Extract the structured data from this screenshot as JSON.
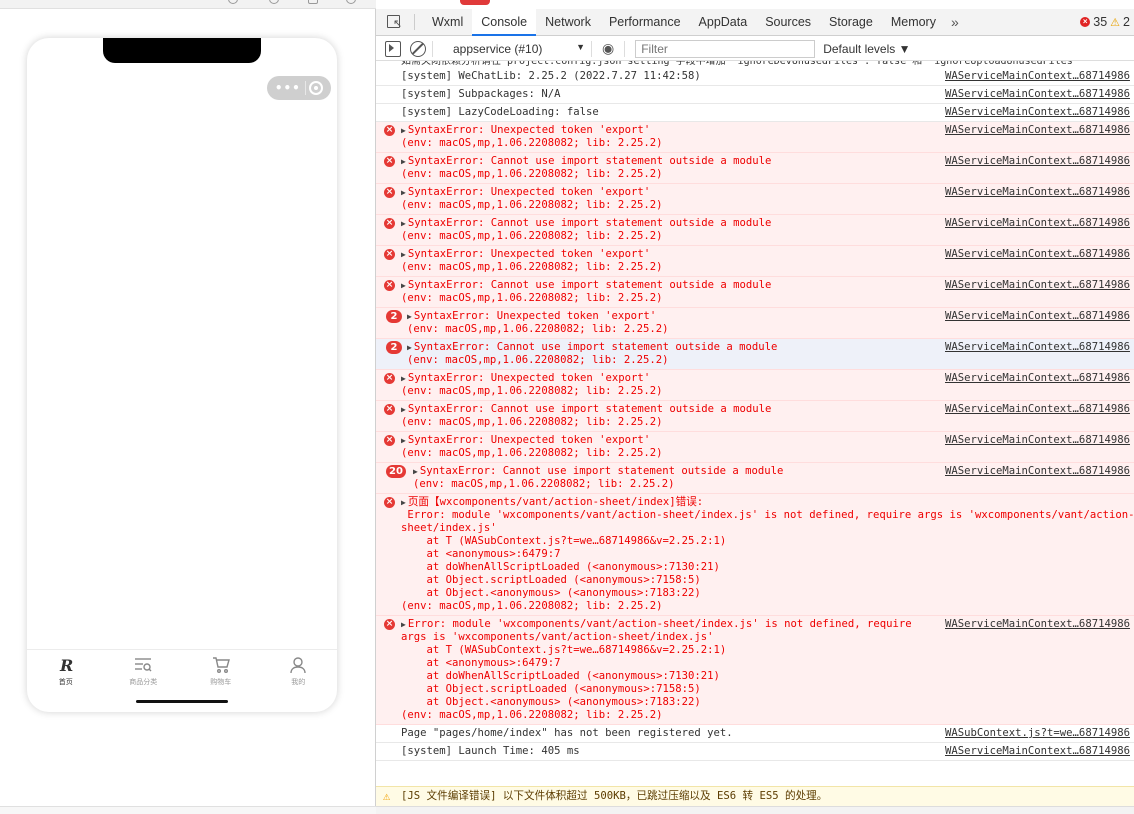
{
  "simulator": {
    "tabbar": [
      {
        "label": "首页",
        "icon": "brand-logo-icon"
      },
      {
        "label": "商品分类",
        "icon": "category-icon"
      },
      {
        "label": "购物车",
        "icon": "cart-icon"
      },
      {
        "label": "我的",
        "icon": "user-icon"
      }
    ]
  },
  "devtools": {
    "tabs": [
      "Wxml",
      "Console",
      "Network",
      "Performance",
      "AppData",
      "Sources",
      "Storage",
      "Memory"
    ],
    "active_tab": "Console",
    "more": "»",
    "error_count": "35",
    "warning_count": "2",
    "context": "appservice (#10)",
    "context_arrow": "▼",
    "filter_placeholder": "Filter",
    "levels": "Default levels ▼",
    "top_truncated": "如需关闭依赖分析请在 project.config.json setting 字段中增加 \"ignoreDevUnusedFiles\": false 和 \"ignoreUploadUnusedFiles\"",
    "rows": [
      {
        "type": "log",
        "text": "[system] WeChatLib: 2.25.2 (2022.7.27 11:42:58)",
        "src": "WAServiceMainContext…68714986"
      },
      {
        "type": "log",
        "text": "[system] Subpackages: N/A",
        "src": "WAServiceMainContext…68714986"
      },
      {
        "type": "log",
        "text": "[system] LazyCodeLoading: false",
        "src": "WAServiceMainContext…68714986"
      },
      {
        "type": "err",
        "text": "SyntaxError: Unexpected token 'export'\n(env: macOS,mp,1.06.2208082; lib: 2.25.2)",
        "src": "WAServiceMainContext…68714986"
      },
      {
        "type": "err",
        "text": "SyntaxError: Cannot use import statement outside a module\n(env: macOS,mp,1.06.2208082; lib: 2.25.2)",
        "src": "WAServiceMainContext…68714986"
      },
      {
        "type": "err",
        "text": "SyntaxError: Unexpected token 'export'\n(env: macOS,mp,1.06.2208082; lib: 2.25.2)",
        "src": "WAServiceMainContext…68714986"
      },
      {
        "type": "err",
        "text": "SyntaxError: Cannot use import statement outside a module\n(env: macOS,mp,1.06.2208082; lib: 2.25.2)",
        "src": "WAServiceMainContext…68714986"
      },
      {
        "type": "err",
        "text": "SyntaxError: Unexpected token 'export'\n(env: macOS,mp,1.06.2208082; lib: 2.25.2)",
        "src": "WAServiceMainContext…68714986"
      },
      {
        "type": "err",
        "text": "SyntaxError: Cannot use import statement outside a module\n(env: macOS,mp,1.06.2208082; lib: 2.25.2)",
        "src": "WAServiceMainContext…68714986"
      },
      {
        "type": "err",
        "count": "2",
        "text": "SyntaxError: Unexpected token 'export'\n(env: macOS,mp,1.06.2208082; lib: 2.25.2)",
        "src": "WAServiceMainContext…68714986"
      },
      {
        "type": "err",
        "count": "2",
        "selected": true,
        "text": "SyntaxError: Cannot use import statement outside a module\n(env: macOS,mp,1.06.2208082; lib: 2.25.2)",
        "src": "WAServiceMainContext…68714986"
      },
      {
        "type": "err",
        "text": "SyntaxError: Unexpected token 'export'\n(env: macOS,mp,1.06.2208082; lib: 2.25.2)",
        "src": "WAServiceMainContext…68714986"
      },
      {
        "type": "err",
        "text": "SyntaxError: Cannot use import statement outside a module\n(env: macOS,mp,1.06.2208082; lib: 2.25.2)",
        "src": "WAServiceMainContext…68714986"
      },
      {
        "type": "err",
        "text": "SyntaxError: Unexpected token 'export'\n(env: macOS,mp,1.06.2208082; lib: 2.25.2)",
        "src": "WAServiceMainContext…68714986"
      },
      {
        "type": "err",
        "count": "20",
        "text": "SyntaxError: Cannot use import statement outside a module\n(env: macOS,mp,1.06.2208082; lib: 2.25.2)",
        "src": "WAServiceMainContext…68714986"
      },
      {
        "type": "err",
        "text": "页面【wxcomponents/vant/action-sheet/index]错误:\n Error: module 'wxcomponents/vant/action-sheet/index.js' is not defined, require args is 'wxcomponents/vant/action-\nsheet/index.js'\n    at T (WASubContext.js?t=we…68714986&v=2.25.2:1)\n    at <anonymous>:6479:7\n    at doWhenAllScriptLoaded (<anonymous>:7130:21)\n    at Object.scriptLoaded (<anonymous>:7158:5)\n    at Object.<anonymous> (<anonymous>:7183:22)\n(env: macOS,mp,1.06.2208082; lib: 2.25.2)",
        "src": ""
      },
      {
        "type": "err",
        "text": "Error: module 'wxcomponents/vant/action-sheet/index.js' is not defined, require\nargs is 'wxcomponents/vant/action-sheet/index.js'\n    at T (WASubContext.js?t=we…68714986&v=2.25.2:1)\n    at <anonymous>:6479:7\n    at doWhenAllScriptLoaded (<anonymous>:7130:21)\n    at Object.scriptLoaded (<anonymous>:7158:5)\n    at Object.<anonymous> (<anonymous>:7183:22)\n(env: macOS,mp,1.06.2208082; lib: 2.25.2)",
        "src": "WAServiceMainContext…68714986"
      },
      {
        "type": "log",
        "text": "Page \"pages/home/index\" has not been registered yet.",
        "src": "WASubContext.js?t=we…68714986"
      },
      {
        "type": "log",
        "text": "[system] Launch Time: 405 ms",
        "src": "WAServiceMainContext…68714986"
      }
    ],
    "warning_bar": "[JS 文件编译错误] 以下文件体积超过 500KB，已跳过压缩以及 ES6 转 ES5 的处理。"
  }
}
